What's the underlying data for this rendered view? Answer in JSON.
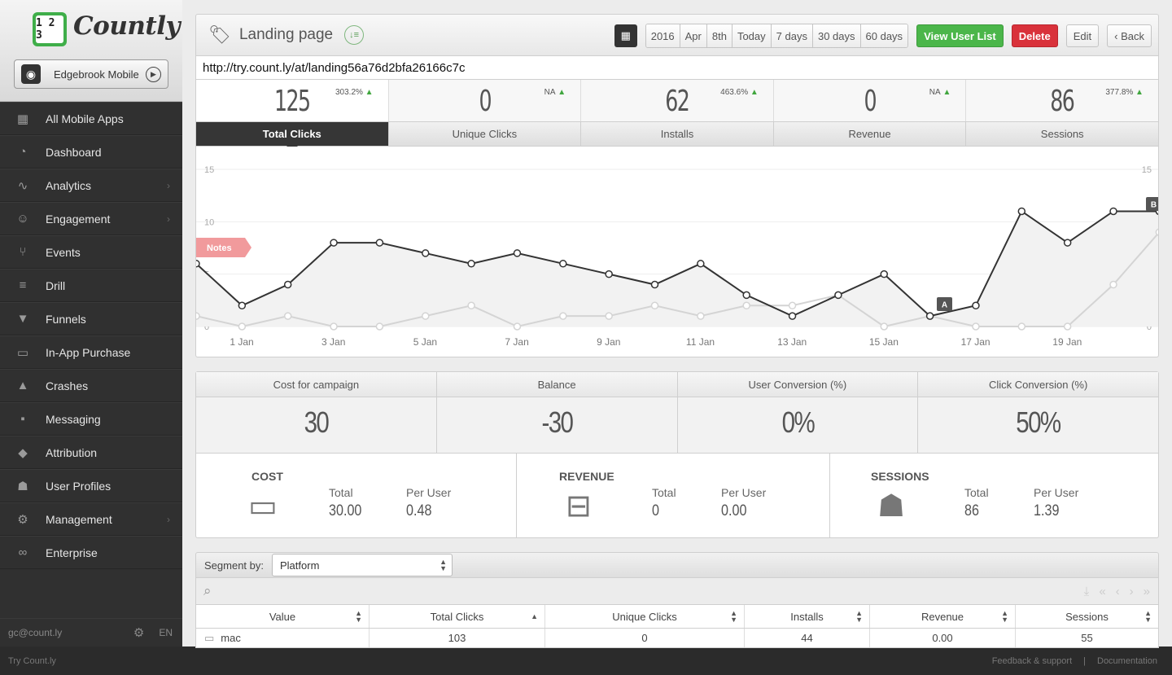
{
  "brand": {
    "logo_glyph": "1 2 3",
    "name": "Countly",
    "accent": "#3fae49"
  },
  "app_selector": {
    "name": "Edgebrook Mobile"
  },
  "sidebar": {
    "items": [
      {
        "label": "All Mobile Apps",
        "icon": "grid-icon",
        "glyph": "▦",
        "arrow": false
      },
      {
        "label": "Dashboard",
        "icon": "gauge-icon",
        "glyph": "◔",
        "arrow": false
      },
      {
        "label": "Analytics",
        "icon": "pulse-icon",
        "glyph": "∿",
        "arrow": true
      },
      {
        "label": "Engagement",
        "icon": "smile-icon",
        "glyph": "☺",
        "arrow": true
      },
      {
        "label": "Events",
        "icon": "fork-icon",
        "glyph": "⑂",
        "arrow": false
      },
      {
        "label": "Drill",
        "icon": "filter-lines-icon",
        "glyph": "≡",
        "arrow": false
      },
      {
        "label": "Funnels",
        "icon": "funnel-icon",
        "glyph": "▼",
        "arrow": false
      },
      {
        "label": "In-App Purchase",
        "icon": "card-icon",
        "glyph": "▭",
        "arrow": false
      },
      {
        "label": "Crashes",
        "icon": "warning-icon",
        "glyph": "▲",
        "arrow": false
      },
      {
        "label": "Messaging",
        "icon": "chat-icon",
        "glyph": "▪",
        "arrow": false
      },
      {
        "label": "Attribution",
        "icon": "tag-icon",
        "glyph": "◆",
        "arrow": false
      },
      {
        "label": "User Profiles",
        "icon": "users-icon",
        "glyph": "☗",
        "arrow": false
      },
      {
        "label": "Management",
        "icon": "gear-icon",
        "glyph": "⚙",
        "arrow": true
      },
      {
        "label": "Enterprise",
        "icon": "infinity-icon",
        "glyph": "∞",
        "arrow": false
      }
    ],
    "footer": {
      "email": "gc@count.ly",
      "lang": "EN"
    }
  },
  "bottombar": {
    "left": "Try Count.ly",
    "feedback": "Feedback & support",
    "separator": "|",
    "docs": "Documentation"
  },
  "header": {
    "title": "Landing page",
    "date_buttons": [
      "2016",
      "Apr",
      "8th",
      "Today",
      "7 days",
      "30 days",
      "60 days"
    ],
    "view_user_list": "View User List",
    "delete": "Delete",
    "edit": "Edit",
    "back": "Back"
  },
  "url": "http://try.count.ly/at/landing56a76d2bfa26166c7c",
  "stats": [
    {
      "value": "125",
      "change": "303.2%",
      "tab": "Total Clicks"
    },
    {
      "value": "0",
      "change": "NA",
      "tab": "Unique Clicks"
    },
    {
      "value": "62",
      "change": "463.6%",
      "tab": "Installs"
    },
    {
      "value": "0",
      "change": "NA",
      "tab": "Revenue"
    },
    {
      "value": "86",
      "change": "377.8%",
      "tab": "Sessions"
    }
  ],
  "chart_data": {
    "type": "line",
    "x": [
      "1 Jan",
      "2 Jan",
      "3 Jan",
      "4 Jan",
      "5 Jan",
      "6 Jan",
      "7 Jan",
      "8 Jan",
      "9 Jan",
      "10 Jan",
      "11 Jan",
      "12 Jan",
      "13 Jan",
      "14 Jan",
      "15 Jan",
      "16 Jan",
      "17 Jan",
      "18 Jan",
      "19 Jan",
      "20 Jan",
      "21 Jan"
    ],
    "x_tick_labels": [
      "1 Jan",
      "3 Jan",
      "5 Jan",
      "7 Jan",
      "9 Jan",
      "11 Jan",
      "13 Jan",
      "15 Jan",
      "17 Jan",
      "19 Jan"
    ],
    "ylim": [
      0,
      15
    ],
    "y_ticks": [
      "0",
      "5",
      "10",
      "15"
    ],
    "series": [
      {
        "values": [
          6,
          2,
          4,
          8,
          8,
          7,
          6,
          7,
          6,
          5,
          4,
          6,
          3,
          1,
          3,
          5,
          1,
          2,
          11,
          8,
          11,
          11
        ],
        "color": "#333333"
      },
      {
        "values": [
          1,
          0,
          1,
          0,
          0,
          1,
          2,
          0,
          1,
          1,
          2,
          1,
          2,
          2,
          3,
          0,
          1,
          0,
          0,
          0,
          4,
          9
        ],
        "color": "#d4d4d4"
      }
    ],
    "notes_label": "Notes",
    "markers": [
      "A",
      "B"
    ],
    "grid": true
  },
  "metrics": [
    {
      "label": "Cost for campaign",
      "value": "30"
    },
    {
      "label": "Balance",
      "value": "-30"
    },
    {
      "label": "User Conversion (%)",
      "value": "0%"
    },
    {
      "label": "Click Conversion (%)",
      "value": "50%"
    }
  ],
  "summary": {
    "total_label": "Total",
    "per_user_label": "Per User",
    "blocks": [
      {
        "title": "COST",
        "icon": "credit-card-icon",
        "total": "30.00",
        "per_user": "0.48"
      },
      {
        "title": "REVENUE",
        "icon": "banknote-icon",
        "total": "0",
        "per_user": "0.00"
      },
      {
        "title": "SESSIONS",
        "icon": "add-user-icon",
        "total": "86",
        "per_user": "1.39"
      }
    ]
  },
  "segment": {
    "label": "Segment by:",
    "value": "Platform"
  },
  "table": {
    "headers": [
      "Value",
      "Total Clicks",
      "Unique Clicks",
      "Installs",
      "Revenue",
      "Sessions"
    ],
    "rows": [
      [
        "mac",
        "103",
        "0",
        "44",
        "0.00",
        "55"
      ]
    ]
  }
}
